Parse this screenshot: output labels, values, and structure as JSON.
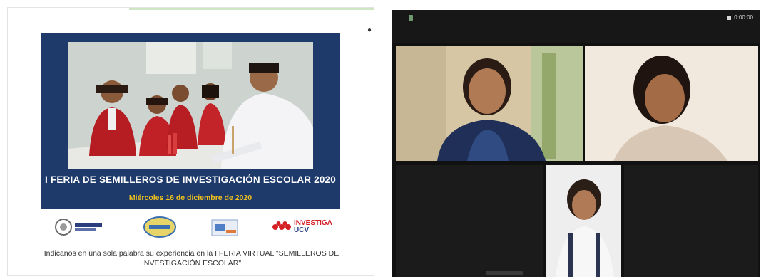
{
  "slide": {
    "edge_mark": "●",
    "poster": {
      "title": "I FERIA DE SEMILLEROS DE INVESTIGACIÓN ESCOLAR  2020",
      "date": "Miércoles 16 de diciembre de 2020"
    },
    "logos": [
      {
        "name": "ugel-logo"
      },
      {
        "name": "institution-logo"
      },
      {
        "name": "school-logo"
      },
      {
        "name": "investiga-ucv-logo",
        "text_line1": "INVESTIGA",
        "text_line2": "UCV"
      }
    ],
    "question_line1": "Indicanos en una sola palabra su experiencia en la I FERIA VIRTUAL \"SEMILLEROS DE",
    "question_line2": "INVESTIGACIÓN ESCOLAR\""
  },
  "call": {
    "status_text": "0:00:00",
    "participants": [
      {
        "name": "participant-1"
      },
      {
        "name": "participant-2"
      },
      {
        "name": "participant-3"
      }
    ]
  },
  "colors": {
    "poster_bg": "#1e3a6b",
    "poster_date": "#f2c21b",
    "call_bg": "#111111"
  }
}
